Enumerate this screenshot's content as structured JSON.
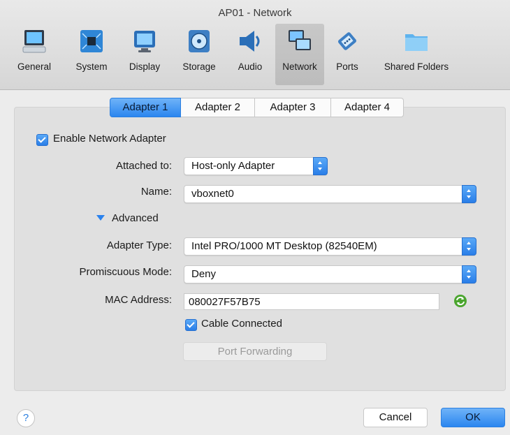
{
  "window": {
    "title": "AP01 - Network"
  },
  "toolbar": {
    "items": [
      {
        "label": "General",
        "icon": "monitor-general-icon"
      },
      {
        "label": "System",
        "icon": "chip-system-icon"
      },
      {
        "label": "Display",
        "icon": "display-icon"
      },
      {
        "label": "Storage",
        "icon": "disk-storage-icon"
      },
      {
        "label": "Audio",
        "icon": "speaker-audio-icon"
      },
      {
        "label": "Network",
        "icon": "network-icon",
        "selected": true
      },
      {
        "label": "Ports",
        "icon": "serial-port-icon"
      },
      {
        "label": "Shared Folders",
        "icon": "folder-icon"
      }
    ]
  },
  "tabs": [
    {
      "label": "Adapter 1",
      "selected": true
    },
    {
      "label": "Adapter 2"
    },
    {
      "label": "Adapter 3"
    },
    {
      "label": "Adapter 4"
    }
  ],
  "form": {
    "enable_label": "Enable Network Adapter",
    "enable_checked": true,
    "attached_label": "Attached to:",
    "attached_value": "Host-only Adapter",
    "name_label": "Name:",
    "name_value": "vboxnet0",
    "advanced_label": "Advanced",
    "adapter_type_label": "Adapter Type:",
    "adapter_type_value": "Intel PRO/1000 MT Desktop (82540EM)",
    "promiscuous_label": "Promiscuous Mode:",
    "promiscuous_value": "Deny",
    "mac_label": "MAC Address:",
    "mac_value": "080027F57B75",
    "cable_label": "Cable Connected",
    "cable_checked": true,
    "port_forwarding_label": "Port Forwarding"
  },
  "footer": {
    "help_label": "?",
    "cancel_label": "Cancel",
    "ok_label": "OK"
  },
  "colors": {
    "accent": "#2b86ef",
    "refresh": "#4aa52e"
  }
}
